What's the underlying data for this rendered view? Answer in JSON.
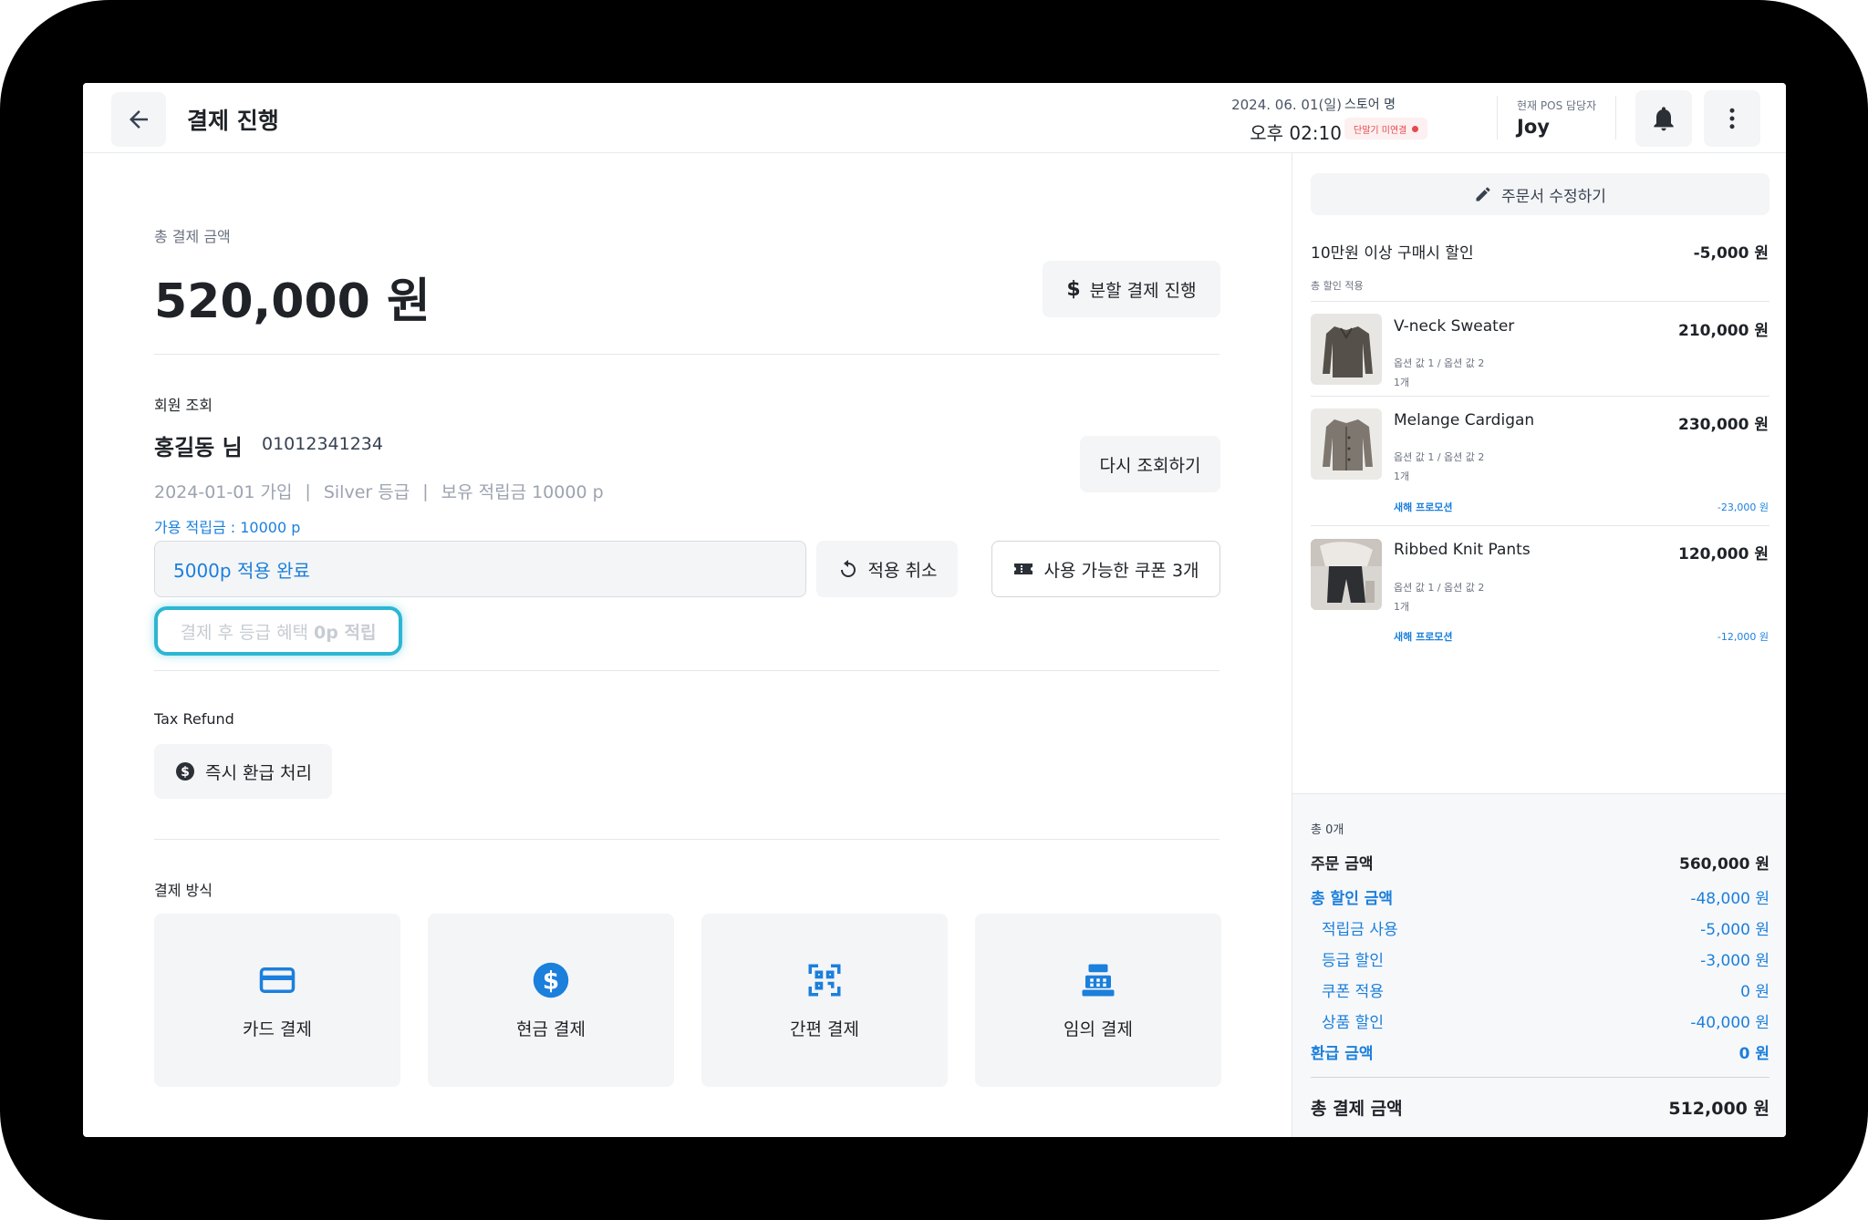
{
  "header": {
    "title": "결제 진행",
    "date": "2024. 06. 01(일)",
    "time": "오후 02:10",
    "store_label": "스토어 명",
    "store_status": "단말기 미연결",
    "staff_label": "현재 POS 담당자",
    "staff_name": "Joy"
  },
  "payment": {
    "total_label": "총 결제 금액",
    "total_amount": "520,000 원",
    "split_button": "분할 결제 진행"
  },
  "member": {
    "section_label": "회원 조회",
    "name": "홍길동 님",
    "phone": "01012341234",
    "joined": "2024-01-01 가입",
    "grade": "Silver 등급",
    "points_held": "보유 적립금 10000 p",
    "research_button": "다시 조회하기",
    "available_points": "가용 적립금 : 10000 p",
    "points_applied": "5000p 적용 완료",
    "cancel_button": "적용 취소",
    "coupon_button": "사용 가능한 쿠폰 3개",
    "benefit_prefix": "결제 후 등급 혜택",
    "benefit_value": "0p 적립"
  },
  "tax_refund": {
    "label": "Tax Refund",
    "button": "즉시 환급 처리"
  },
  "methods": {
    "label": "결제 방식",
    "items": [
      {
        "label": "카드 결제",
        "icon": "credit-card-icon"
      },
      {
        "label": "현금 결제",
        "icon": "dollar-icon"
      },
      {
        "label": "간편 결제",
        "icon": "qr-code-icon"
      },
      {
        "label": "임의 결제",
        "icon": "cash-register-icon"
      }
    ]
  },
  "order": {
    "edit_button": "주문서 수정하기",
    "discount_name": "10만원 이상 구매시 할인",
    "discount_value": "-5,000 원",
    "discount_sub": "총 할인 적용",
    "products": [
      {
        "name": "V-neck Sweater",
        "price": "210,000 원",
        "options": "옵션 값 1 / 옵션 값 2",
        "qty": "1개"
      },
      {
        "name": "Melange Cardigan",
        "price": "230,000 원",
        "options": "옵션 값 1 / 옵션 값 2",
        "qty": "1개",
        "promo": "새해 프로모션",
        "promo_value": "-23,000 원"
      },
      {
        "name": "Ribbed Knit Pants",
        "price": "120,000 원",
        "options": "옵션 값 1 / 옵션 값 2",
        "qty": "1개",
        "promo": "새해 프로모션",
        "promo_value": "-12,000 원"
      }
    ]
  },
  "summary": {
    "count": "총 0개",
    "order_amount_label": "주문 금액",
    "order_amount": "560,000 원",
    "discount_total_label": "총 할인 금액",
    "discount_total": "-48,000 원",
    "points_label": "적립금 사용",
    "points": "-5,000 원",
    "grade_label": "등급 할인",
    "grade": "-3,000 원",
    "coupon_label": "쿠폰 적용",
    "coupon": "0 원",
    "product_label": "상품 할인",
    "product": "-40,000 원",
    "refund_label": "환급 금액",
    "refund": "0 원",
    "final_label": "총 결제 금액",
    "final": "512,000 원"
  },
  "colors": {
    "accent": "#1b7fdc",
    "highlight": "#2cb6d2",
    "alert": "#e5484d"
  }
}
